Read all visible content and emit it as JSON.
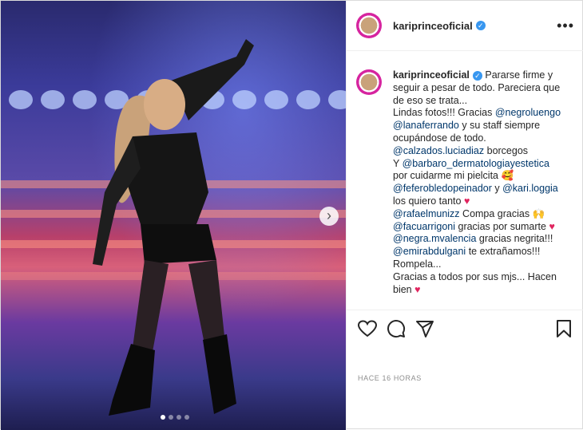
{
  "post": {
    "username": "kariprinceoficial",
    "verified_symbol": "✓",
    "more_symbol": "•••",
    "caption": {
      "username": "kariprinceoficial",
      "lines": [
        {
          "text": "Pararse firme y"
        },
        {
          "text": "seguir a pesar de todo. Pareciera que"
        },
        {
          "text": "de eso se trata..."
        },
        {
          "text": "Lindas fotos!!! Gracias ",
          "mention": "@negroluengo"
        },
        {
          "mention": "@lanaferrando",
          "text": " y su staff siempre"
        },
        {
          "text": "ocupándose de todo."
        },
        {
          "mention": "@calzados.luciadiaz",
          "text": " borcegos"
        },
        {
          "text": "Y ",
          "mention": "@barbaro_dermatologiayestetica"
        },
        {
          "text": "por cuidarme mi pielcita ",
          "emoji": "🥰"
        },
        {
          "mention": "@feferobledopeinador",
          "text": " y ",
          "mention2": "@kari.loggia"
        },
        {
          "text": "los quiero tanto ",
          "heart": "♥"
        },
        {
          "mention": "@rafaelmunizz",
          "text": " Compa gracias ",
          "emoji": "🙌"
        },
        {
          "mention": "@facuarrigoni",
          "text": " gracias por sumarte ",
          "heart": "♥"
        },
        {
          "mention": "@negra.mvalencia",
          "text": " gracias negrita!!!"
        },
        {
          "mention": "@emirabdulgani",
          "text": " te extrañamos!!!"
        },
        {
          "text": "Rompela..."
        },
        {
          "text": "Gracias a todos por sus mjs... Hacen"
        },
        {
          "text": "bien ",
          "heart": "♥"
        }
      ]
    },
    "timestamp": "HACE 16 HORAS",
    "carousel": {
      "count": 4,
      "active": 0,
      "next_symbol": "›"
    },
    "icons": [
      "heart-icon",
      "comment-icon",
      "share-icon",
      "bookmark-icon"
    ],
    "colors": {
      "mention": "#00376b",
      "heart": "#e0245e",
      "verified": "#3897f0"
    }
  }
}
